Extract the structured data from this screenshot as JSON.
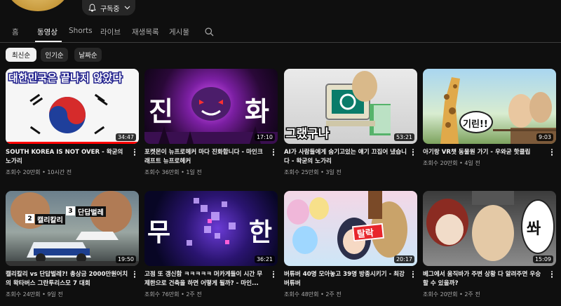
{
  "header": {
    "subscribe_label": "구독중"
  },
  "tabs": [
    {
      "label": "홈"
    },
    {
      "label": "동영상"
    },
    {
      "label": "Shorts"
    },
    {
      "label": "라이브"
    },
    {
      "label": "재생목록"
    },
    {
      "label": "게시물"
    }
  ],
  "chips": [
    {
      "label": "최신순"
    },
    {
      "label": "인기순"
    },
    {
      "label": "날짜순"
    }
  ],
  "videos": [
    {
      "title": "SOUTH KOREA IS NOT OVER - 왁굳의 노가리",
      "meta": "조회수 20만회 • 10시간 전",
      "duration": "34:47",
      "overlay": "대한민국은 끝나지 않았다"
    },
    {
      "title": "포켓몬이 뉴프로헤커 마다 진화합니다 - 마인크래프트 뉴프로헤커",
      "meta": "조회수 36만회 • 1일 전",
      "duration": "17:10",
      "overlay_left": "진",
      "overlay_right": "화"
    },
    {
      "title": "AI가 사람들에게 숨기고있는 얘기 끄집어 냈습니다 - 왁굳의 노가리",
      "meta": "조회수 25만회 • 3일 전",
      "duration": "53:21",
      "overlay": "그랬구나"
    },
    {
      "title": "아기랑 VR챗 동물원 가기 - 우와굳 핫클립",
      "meta": "조회수 20만회 • 4일 전",
      "duration": "9:03",
      "overlay": "기린!!"
    },
    {
      "title": "캘리칼리 vs 단답벌레?! 총상금 2000만원어치의 왁타버스 그란투리스모 7 대회",
      "meta": "조회수 24만회 • 9일 전",
      "duration": "19:50",
      "overlay_a": "캘리칼리",
      "overlay_b": "단답벌레",
      "badge_a": "2",
      "badge_b": "3"
    },
    {
      "title": "고점 또 갱신함 ㅋㅋㅋㅋㅋ 머카게들이 시간 무제한으로 건축을 하면 어떻게 될까? - 마인...",
      "meta": "조회수 76만회 • 2주 전",
      "duration": "36:21",
      "overlay_left": "무",
      "overlay_right": "한"
    },
    {
      "title": "버튜버 40명 모아놓고 39명 방종시키기 - 최강버튜버",
      "meta": "조회수 48만회 • 2주 전",
      "duration": "20:17",
      "overlay": "탈락"
    },
    {
      "title": "베그에서 움직바가 주변 상황 다 알려주면 우승할 수 있을까?",
      "meta": "조회수 20만회 • 2주 전",
      "duration": "15:09",
      "overlay": "쏴"
    }
  ],
  "colors": {
    "accent": "#ff0000",
    "background": "#0f0f0f",
    "chip_active": "#f1f1f1"
  }
}
